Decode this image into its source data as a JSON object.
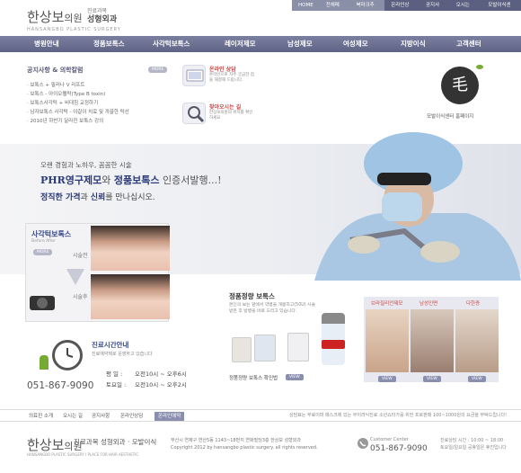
{
  "header": {
    "logo": "한상보",
    "logo_suffix": "의원",
    "sub1": "진료과목",
    "sub2": "성형외과",
    "en": "HANSANGBO  PLASTIC SURGERY",
    "util": [
      "HOME",
      "전체메뉴",
      "북마크추가",
      "온라인상담",
      "공지사항",
      "오시는 길",
      "모발이식센터"
    ]
  },
  "nav": [
    "병원안내",
    "정품보톡스",
    "사각턱보톡스",
    "레이저제모",
    "남성제모",
    "여성제모",
    "지방이식",
    "고객센터"
  ],
  "notice": {
    "title": "공지사항 & 의학칼럼",
    "more": "MORE",
    "items": [
      "보톡스 + 필러나 V 리프트",
      "보톡스 - 아이오펠락(Type B toxin)",
      "보톡스사각턱 + 비대칭 교정하기",
      "남자보톡스 사각턱 - 이갈이 치료 및 까끌한 턱선",
      "2010년 하반기 달라진 보톡스 강의"
    ]
  },
  "quick": [
    {
      "title": "온라인 상담",
      "desc": "온라인으로 자주 궁금한 점을 해결해 드립니다."
    },
    {
      "title": "찾아오시는 길",
      "desc": "한상보의원의 위치를 확인하세요"
    }
  ],
  "badge": {
    "glyph": "毛",
    "label": "모발이식센터 홈페이지"
  },
  "hero": {
    "line1": "오랜 경험과 노하우, 꼼꼼한 시술",
    "line2_a": "PHR영구제모",
    "line2_b": "와 ",
    "line2_c": "정품보톡스",
    "line2_d": " 인증서발행...!",
    "line3_a": "정직한 가격",
    "line3_b": "과 ",
    "line3_c": "신뢰",
    "line3_d": "를 만나십시오."
  },
  "before_after": {
    "title": "사각턱보톡스",
    "sub": "Before After",
    "more": "MORE",
    "before": "시술전",
    "after": "시술후"
  },
  "hours": {
    "title": "진료시간안내",
    "sub": "진료예약제로 운영하고 있습니다",
    "weekday_label": "평    일 :",
    "weekday": "오전10시 ~ 오후6시",
    "sat_label": "토요일 :",
    "sat": "오전10시 ~ 오후2시",
    "phone": "051-867-9090"
  },
  "product": {
    "title": "정품정량 보톡스",
    "desc": "본인의 보는 앞에서 약병을 개봉하고(50U) 시술 받은 후 방병을 바로 드리고 있습니다.",
    "button": "정품정량 보톡스 확인법",
    "view": "VIEW"
  },
  "photos": {
    "labels": [
      "브라질리언제모",
      "남성인면",
      "다한증"
    ],
    "view": "VIEW"
  },
  "footer": {
    "links": [
      "의료진 소개",
      "오시는 길",
      "공지사항",
      "온라인상담",
      "온라인예약"
    ],
    "right": "상담료는 무료이며 메스크에 있는 부이러닉진료 소년쇼터가를 위한 프로판매 100~1000원의 요금을 부탁드립니다!",
    "logo": "한상보",
    "logo_suffix": "의원",
    "sub": "진료과목 성형외과 · 모발이식",
    "en": "HANSANGBO  PLASTIC SURGERY  I  PLACE FOR HAIR AESTHETIC",
    "addr1": "부산시 연제구 연산5동 1143~18번지 연화빌딩3층 한상보 성형외과",
    "addr2": "Copyright 2012 by hansangbo plastic surgery. all rights reserved.",
    "cc_label": "Customer Center",
    "cc_phone": "051-867-9090",
    "hrs1": "진료상담 시간 : 10:00 ~ 18:00",
    "hrs2": "토요일/일요일 공휴일은 휴진입니다"
  }
}
